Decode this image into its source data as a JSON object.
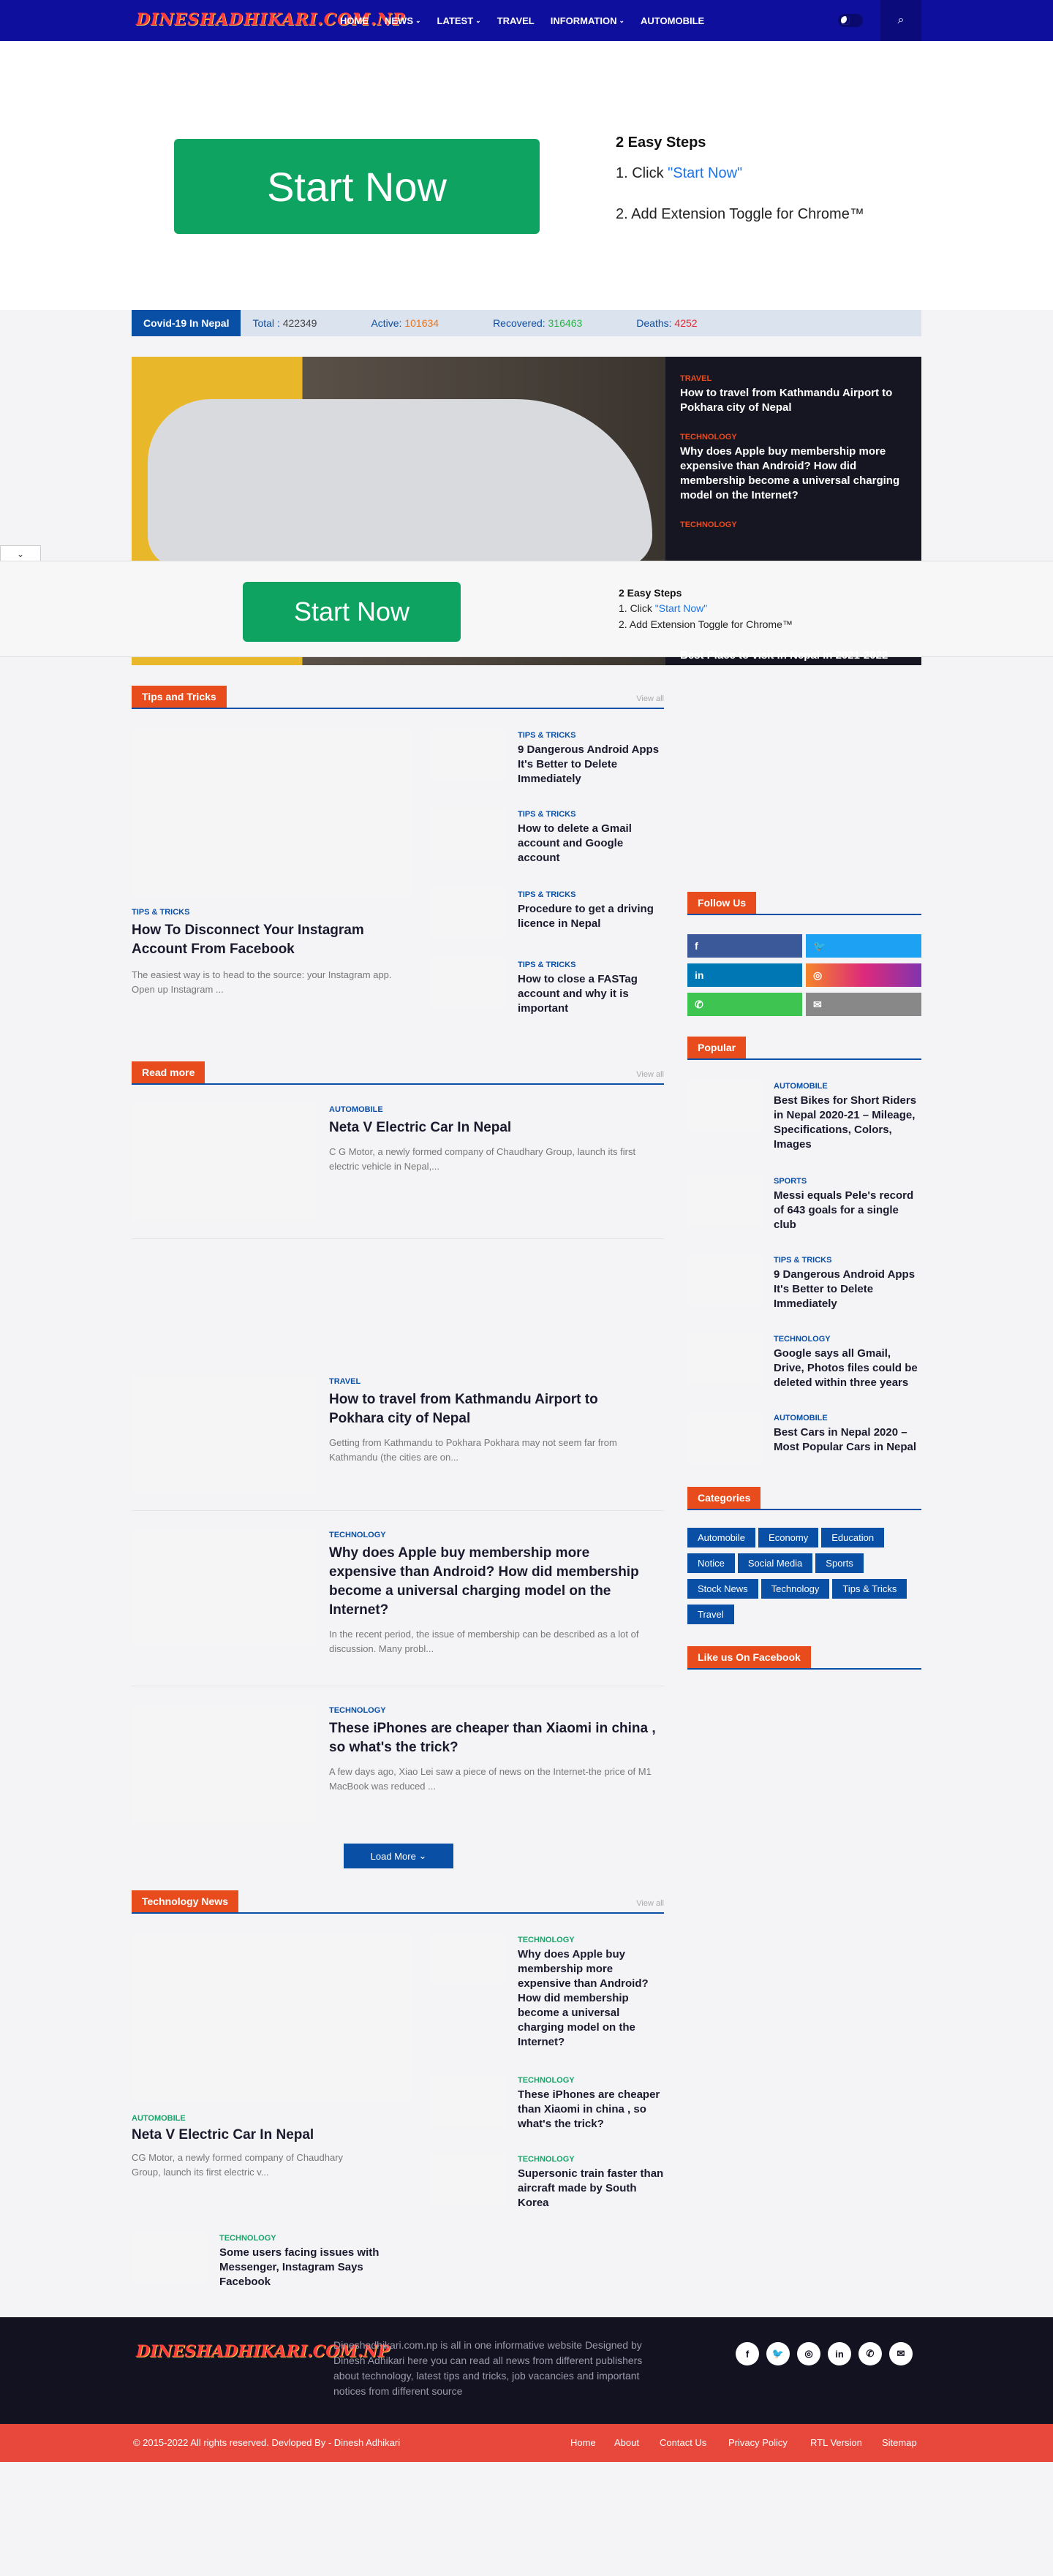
{
  "header": {
    "logo": "DINESHADHIKARI.COM.NP",
    "nav": [
      {
        "label": "HOME",
        "dropdown": false
      },
      {
        "label": "NEWS",
        "dropdown": true
      },
      {
        "label": "LATEST",
        "dropdown": true
      },
      {
        "label": "TRAVEL",
        "dropdown": false
      },
      {
        "label": "INFORMATION",
        "dropdown": true
      },
      {
        "label": "AUTOMOBILE",
        "dropdown": false
      }
    ]
  },
  "ad_top": {
    "button": "Start Now",
    "steps_title": "2 Easy Steps",
    "step1_prefix": "1. Click ",
    "step1_link": "\"Start Now\"",
    "step2": "2. Add Extension Toggle for Chrome™"
  },
  "covid": {
    "label": "Covid-19 In Nepal",
    "total_label": "Total :",
    "total": "422349",
    "active_label": "Active:",
    "active": "101634",
    "recovered_label": "Recovered:",
    "recovered": "316463",
    "deaths_label": "Deaths:",
    "deaths": "4252",
    "colors": {
      "active": "#e8731c",
      "recovered": "#2bb34a",
      "deaths": "#e8242f"
    }
  },
  "hero": {
    "side": [
      {
        "cat": "TRAVEL",
        "title": "How to travel from Kathmandu Airport to Pokhara city of Nepal"
      },
      {
        "cat": "TECHNOLOGY",
        "title": "Why does Apple buy membership more expensive than Android? How did membership become a universal charging model on the Internet?"
      },
      {
        "cat": "TECHNOLOGY",
        "title": ""
      }
    ],
    "last": "Best Place to visit in Nepal in 2021-2022"
  },
  "ad_bottom": {
    "button": "Start Now",
    "steps_title": "2 Easy Steps",
    "step1_prefix": "1. Click ",
    "step1_link": "\"Start Now\"",
    "step2": "2. Add Extension Toggle for Chrome™",
    "collapse": "⌄"
  },
  "tips": {
    "title": "Tips and Tricks",
    "view_all": "View all",
    "main": {
      "cat": "TIPS & TRICKS",
      "title": "How To Disconnect Your Instagram Account From Facebook",
      "excerpt": "The easiest way is to head to the source: your Instagram app. Open up Instagram ..."
    },
    "items": [
      {
        "cat": "TIPS & TRICKS",
        "title": "9 Dangerous Android Apps It's Better to Delete Immediately"
      },
      {
        "cat": "TIPS & TRICKS",
        "title": "How to delete a Gmail account and Google account"
      },
      {
        "cat": "TIPS & TRICKS",
        "title": "Procedure to get a driving licence in Nepal"
      },
      {
        "cat": "TIPS & TRICKS",
        "title": "How to close a FASTag account and why it is important"
      }
    ]
  },
  "readmore": {
    "title": "Read more",
    "view_all": "View all",
    "posts": [
      {
        "cat": "AUTOMOBILE",
        "title": "Neta V Electric Car In Nepal",
        "excerpt": "C G Motor, a newly formed company of Chaudhary Group, launch its first electric vehicle in Nepal,..."
      },
      {
        "cat": "TRAVEL",
        "title": "How to travel from Kathmandu Airport to Pokhara city of Nepal",
        "excerpt": "Getting from Kathmandu to Pokhara Pokhara may not seem far from Kathmandu (the cities are on..."
      },
      {
        "cat": "TECHNOLOGY",
        "title": "Why does Apple buy membership more expensive than Android? How did membership become a universal charging model on the Internet?",
        "excerpt": "In the recent period, the issue of membership can be described as a lot of discussion. Many probl..."
      },
      {
        "cat": "TECHNOLOGY",
        "title": "These iPhones are cheaper than Xiaomi in china , so what's the trick?",
        "excerpt": "A few days ago, Xiao Lei saw a piece of news on the Internet-the price of M1 MacBook was reduced ..."
      }
    ],
    "load_more": "Load More"
  },
  "technews": {
    "title": "Technology News",
    "view_all": "View all",
    "main": {
      "cat": "AUTOMOBILE",
      "title": "Neta V Electric Car In Nepal",
      "excerpt": "CG Motor, a newly formed company of Chaudhary Group, launch its first electric v..."
    },
    "items": [
      {
        "cat": "TECHNOLOGY",
        "title": "Why does Apple buy membership more expensive than Android? How did membership become a universal charging model on the Internet?"
      },
      {
        "cat": "TECHNOLOGY",
        "title": "These iPhones are cheaper than Xiaomi in china , so what's the trick?"
      },
      {
        "cat": "TECHNOLOGY",
        "title": "Supersonic train faster than aircraft made by South Korea"
      }
    ],
    "extra": {
      "cat": "TECHNOLOGY",
      "title": "Some users facing issues with Messenger, Instagram Says Facebook"
    }
  },
  "sidebar": {
    "follow_title": "Follow Us",
    "social": [
      {
        "icon": "facebook-icon",
        "glyph": "f",
        "color": "#3b5998"
      },
      {
        "icon": "twitter-icon",
        "glyph": "🐦",
        "color": "#1da1f2"
      },
      {
        "icon": "linkedin-icon",
        "glyph": "in",
        "color": "#0077b5"
      },
      {
        "icon": "instagram-icon",
        "glyph": "◎",
        "color": "#c13584"
      },
      {
        "icon": "whatsapp-icon",
        "glyph": "✆",
        "color": "#3ec451"
      },
      {
        "icon": "email-icon",
        "glyph": "✉",
        "color": "#888888"
      }
    ],
    "popular_title": "Popular",
    "popular": [
      {
        "cat": "AUTOMOBILE",
        "title": "Best Bikes for Short Riders in Nepal 2020-21 – Mileage, Specifications, Colors, Images"
      },
      {
        "cat": "SPORTS",
        "title": "Messi equals Pele's record of 643 goals for a single club"
      },
      {
        "cat": "TIPS & TRICKS",
        "title": "9 Dangerous Android Apps It's Better to Delete Immediately"
      },
      {
        "cat": "TECHNOLOGY",
        "title": "Google says all Gmail, Drive, Photos files could be deleted within three years"
      },
      {
        "cat": "AUTOMOBILE",
        "title": "Best Cars in Nepal 2020 – Most Popular Cars in Nepal"
      }
    ],
    "categories_title": "Categories",
    "categories": [
      "Automobile",
      "Economy",
      "Education",
      "Notice",
      "Social Media",
      "Sports",
      "Stock News",
      "Technology",
      "Tips & Tricks",
      "Travel"
    ],
    "like_title": "Like us On Facebook"
  },
  "footer": {
    "logo": "DINESHADHIKARI.COM.NP",
    "description": "Dineshadhikari.com.np is all in one informative website Designed by Dinesh Adhikari here you can read all news from different publishers about technology, latest tips and tricks, job vacancies and important notices from different source",
    "copyright": "© 2015-2022 All rights reserved. Devloped By - Dinesh Adhikari",
    "links": [
      "Home",
      "About",
      "Contact Us",
      "Privacy Policy",
      "RTL Version",
      "Sitemap"
    ],
    "social": [
      {
        "icon": "facebook-icon",
        "glyph": "f"
      },
      {
        "icon": "twitter-icon",
        "glyph": "🐦"
      },
      {
        "icon": "instagram-icon",
        "glyph": "◎"
      },
      {
        "icon": "linkedin-icon",
        "glyph": "in"
      },
      {
        "icon": "whatsapp-icon",
        "glyph": "✆"
      },
      {
        "icon": "email-icon",
        "glyph": "✉"
      }
    ]
  },
  "colors": {
    "brand": "#0f0f9e",
    "accent": "#e84c1c",
    "link": "#0a4fa6",
    "green_cat": "#1aa36a"
  }
}
